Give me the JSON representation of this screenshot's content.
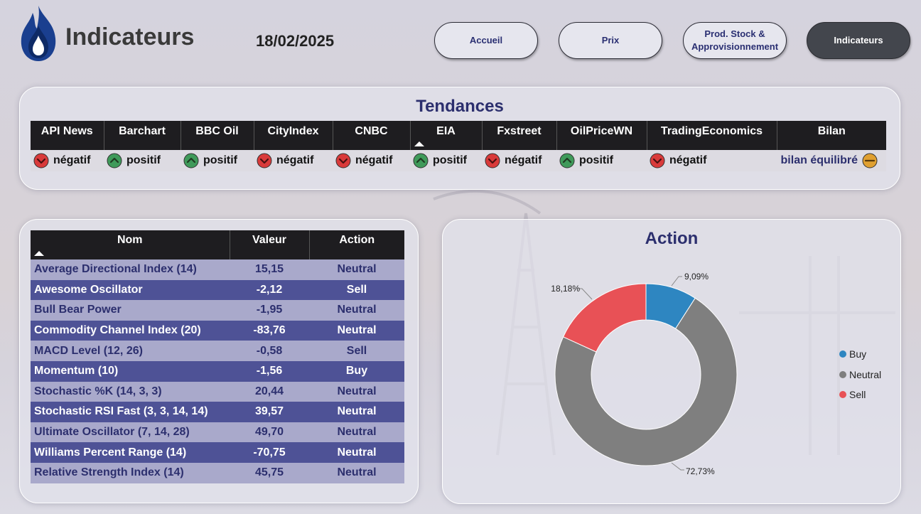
{
  "header": {
    "title": "Indicateurs",
    "date": "18/02/2025",
    "nav": [
      {
        "label": "Accueil",
        "active": false
      },
      {
        "label": "Prix",
        "active": false
      },
      {
        "label": "Prod. Stock &\nApprovisionnement",
        "active": false
      },
      {
        "label": "Indicateurs",
        "active": true
      }
    ]
  },
  "tendances": {
    "title": "Tendances",
    "columns": [
      "API News",
      "Barchart",
      "BBC Oil",
      "CityIndex",
      "CNBC",
      "EIA",
      "Fxstreet",
      "OilPriceWN",
      "TradingEconomics",
      "Bilan"
    ],
    "sorted_column": "EIA",
    "values": [
      {
        "label": "négatif",
        "status": "down"
      },
      {
        "label": "positif",
        "status": "up"
      },
      {
        "label": "positif",
        "status": "up"
      },
      {
        "label": "négatif",
        "status": "down"
      },
      {
        "label": "négatif",
        "status": "down"
      },
      {
        "label": "positif",
        "status": "up"
      },
      {
        "label": "négatif",
        "status": "down"
      },
      {
        "label": "positif",
        "status": "up"
      },
      {
        "label": "négatif",
        "status": "down"
      }
    ],
    "bilan": {
      "label": "bilan équilibré",
      "status": "neutral"
    }
  },
  "indicators": {
    "headers": [
      "Nom",
      "Valeur",
      "Action"
    ],
    "rows": [
      {
        "name": "Average Directional Index (14)",
        "value": "15,15",
        "action": "Neutral"
      },
      {
        "name": "Awesome Oscillator",
        "value": "-2,12",
        "action": "Sell"
      },
      {
        "name": "Bull Bear Power",
        "value": "-1,95",
        "action": "Neutral"
      },
      {
        "name": "Commodity Channel Index (20)",
        "value": "-83,76",
        "action": "Neutral"
      },
      {
        "name": "MACD Level (12, 26)",
        "value": "-0,58",
        "action": "Sell"
      },
      {
        "name": "Momentum (10)",
        "value": "-1,56",
        "action": "Buy"
      },
      {
        "name": "Stochastic %K (14, 3, 3)",
        "value": "20,44",
        "action": "Neutral"
      },
      {
        "name": "Stochastic RSI Fast (3, 3, 14, 14)",
        "value": "39,57",
        "action": "Neutral"
      },
      {
        "name": "Ultimate Oscillator (7, 14, 28)",
        "value": "49,70",
        "action": "Neutral"
      },
      {
        "name": "Williams Percent Range (14)",
        "value": "-70,75",
        "action": "Neutral"
      },
      {
        "name": "Relative Strength Index (14)",
        "value": "45,75",
        "action": "Neutral"
      }
    ]
  },
  "colors": {
    "up": "#3f9a5a",
    "down": "#d93a3a",
    "neutral": "#e0a030",
    "buy": "#2e86c1",
    "neutral_slice": "#7f7f7f",
    "sell": "#e85156",
    "title": "#2c2f6e"
  },
  "chart_data": {
    "type": "pie",
    "title": "Action",
    "categories": [
      "Buy",
      "Neutral",
      "Sell"
    ],
    "values": [
      9.09,
      72.73,
      18.18
    ],
    "labels": [
      "9,09%",
      "72,73%",
      "18,18%"
    ],
    "legend": "right"
  }
}
